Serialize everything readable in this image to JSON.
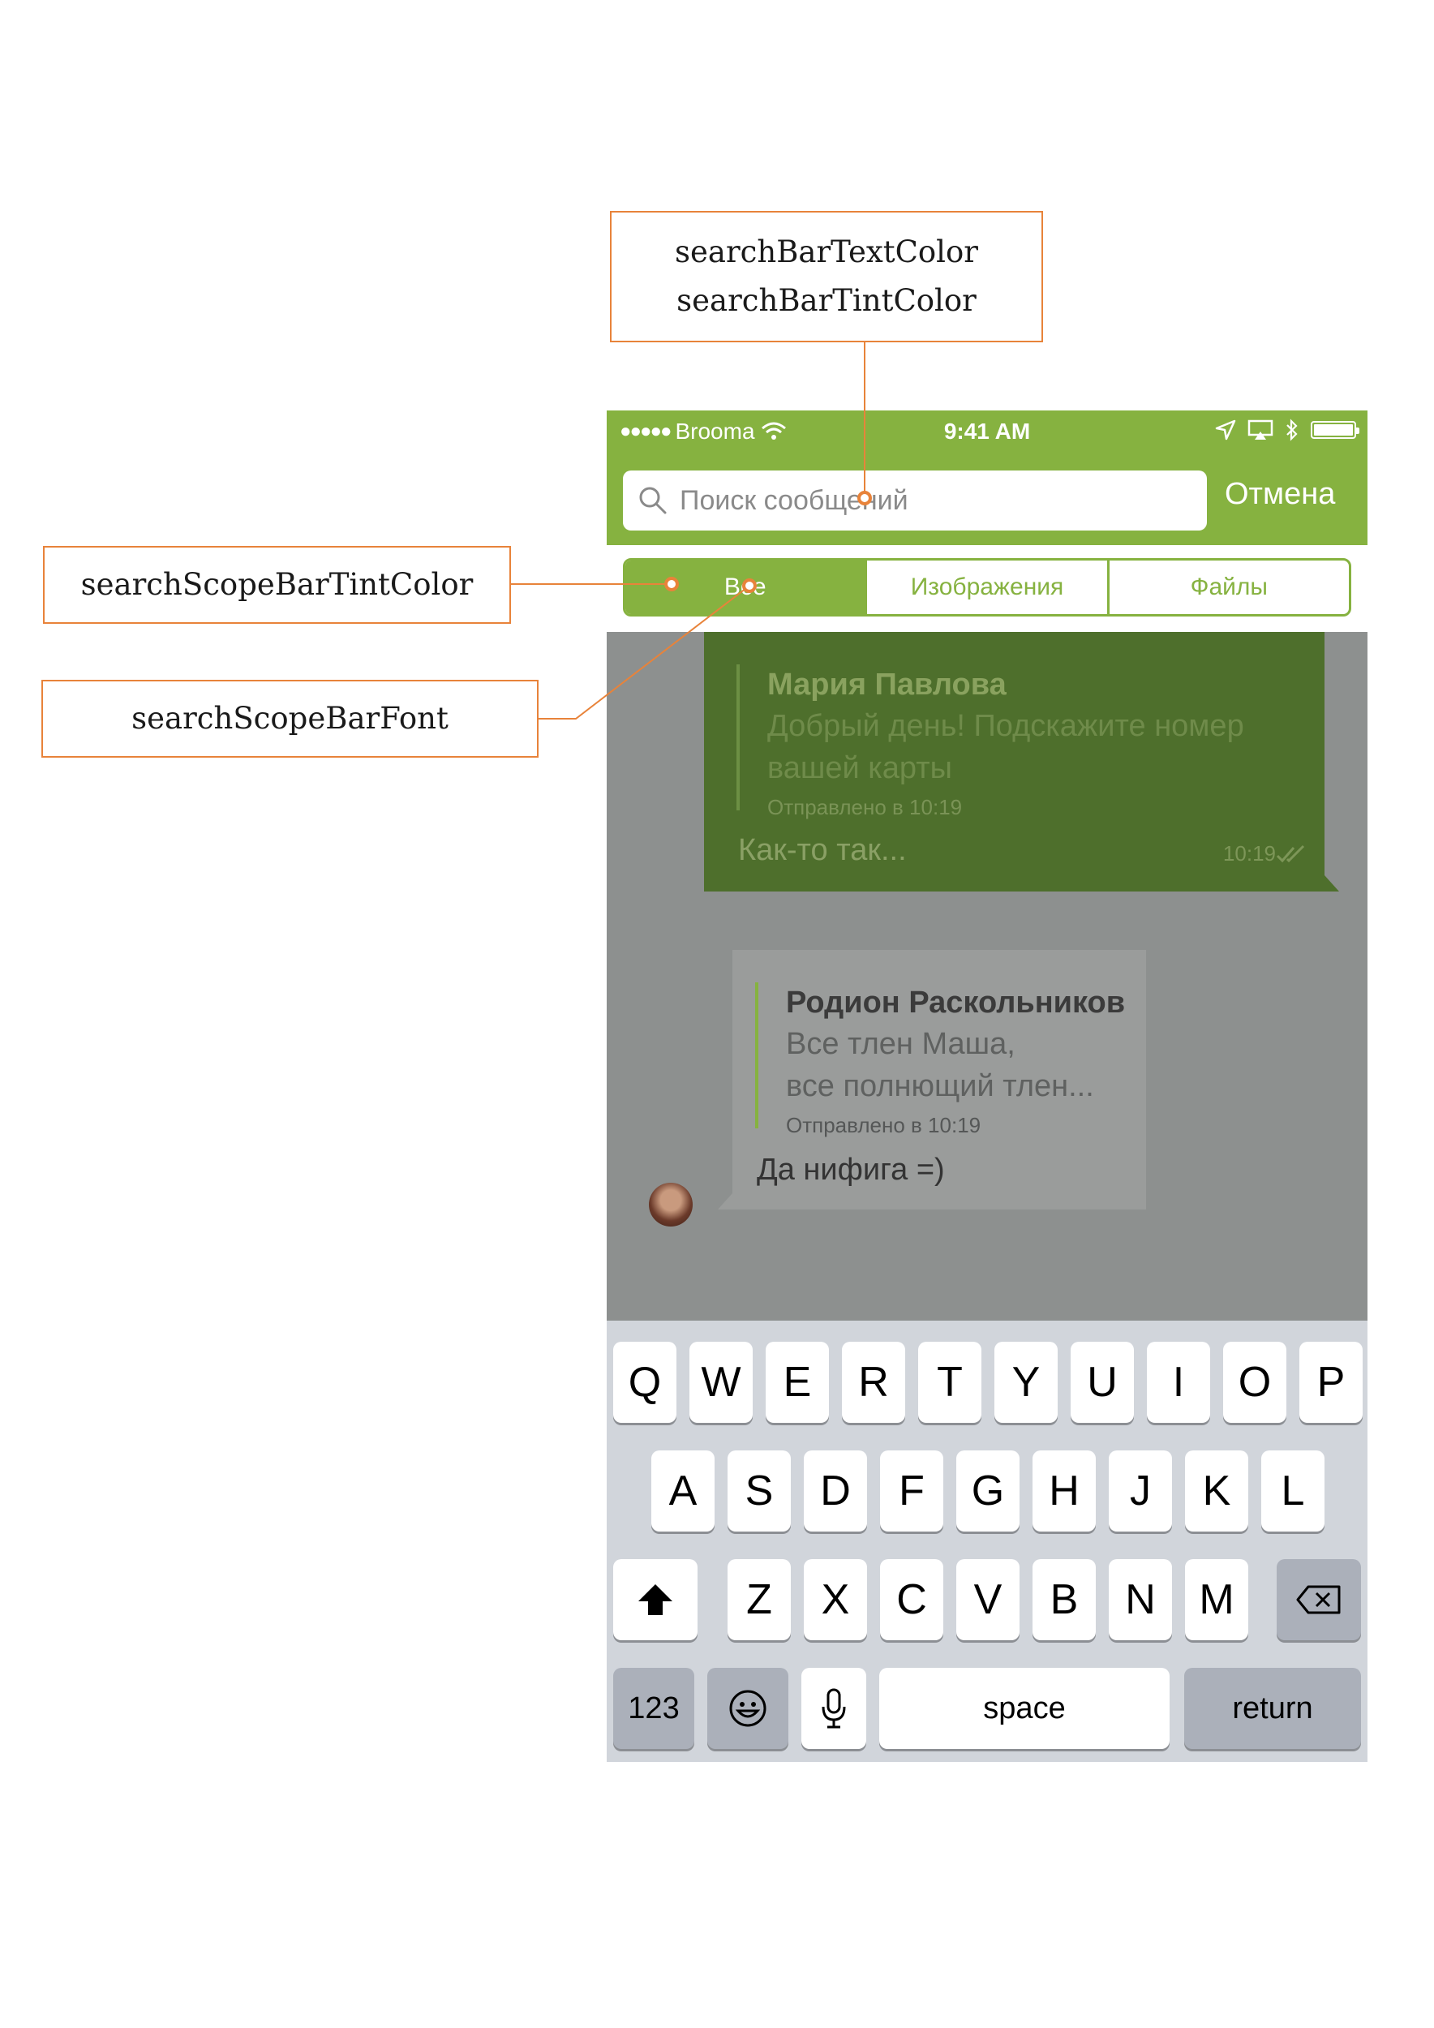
{
  "annotations": {
    "search_bar_text_color": "searchBarTextColor",
    "search_bar_tint_color": "searchBarTintColor",
    "scope_bar_tint_color": "searchScopeBarTintColor",
    "scope_bar_font": "searchScopeBarFont",
    "accent_color": "#e8833a"
  },
  "status_bar": {
    "signal": "●●●●●",
    "carrier": "Brooma",
    "time": "9:41 AM"
  },
  "search": {
    "placeholder": "Поиск сообщений",
    "value": "",
    "cancel_label": "Отмена"
  },
  "scope_bar": {
    "segments": [
      "Все",
      "Изображения",
      "Файлы"
    ],
    "selected": "Все"
  },
  "messages": {
    "outgoing": {
      "quote_author": "Мария Павлова",
      "quote_line1": "Добрый день! Подскажите номер",
      "quote_line2": "вашей карты",
      "quote_sent": "Отправлено в 10:19",
      "text": "Как-то так...",
      "time": "10:19"
    },
    "incoming": {
      "quote_author": "Родион Раскольников",
      "quote_line1": "Все тлен Маша,",
      "quote_line2": "все полнющий тлен...",
      "quote_sent": "Отправлено в 10:19",
      "text": "Да нифига =)"
    }
  },
  "keyboard": {
    "row1": [
      "Q",
      "W",
      "E",
      "R",
      "T",
      "Y",
      "U",
      "I",
      "O",
      "P"
    ],
    "row2": [
      "A",
      "S",
      "D",
      "F",
      "G",
      "H",
      "J",
      "K",
      "L"
    ],
    "row3": [
      "Z",
      "X",
      "C",
      "V",
      "B",
      "N",
      "M"
    ],
    "numbers_label": "123",
    "space_label": "space",
    "return_label": "return"
  },
  "colors": {
    "brand_green": "#86b240",
    "outgoing_bubble": "#4e6f2c",
    "overlay_gray": "#8d908f",
    "keyboard_bg": "#d1d5db"
  }
}
